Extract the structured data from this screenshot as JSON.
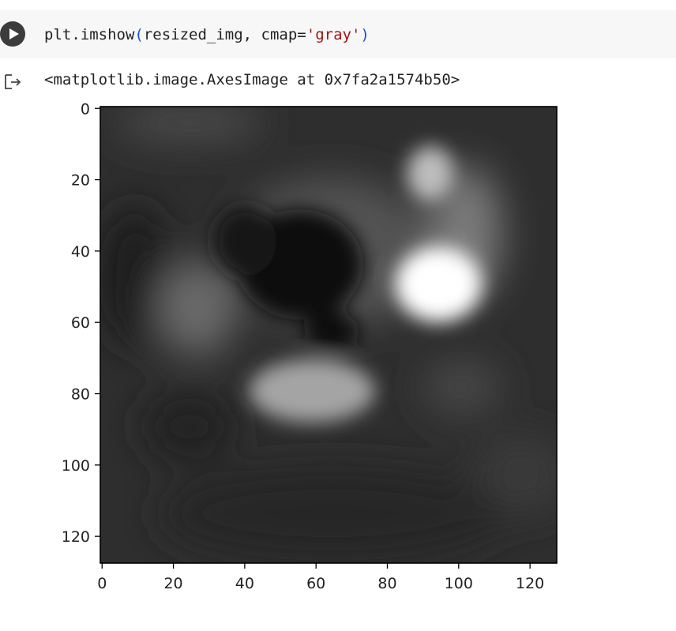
{
  "cell": {
    "code": {
      "fn": "plt.imshow",
      "open_paren": "(",
      "args": "resized_img, cmap=",
      "string_arg": "'gray'",
      "close_paren": ")"
    },
    "output": "<matplotlib.image.AxesImage at 0x7fa2a1574b50>"
  },
  "colors": {
    "run_button": "#3c3c3c",
    "cell_background": "#f7f7f7",
    "paren": "#1a4fd6",
    "string": "#a31515"
  },
  "icons": {
    "run": "play-circle-icon",
    "output": "output-arrow-icon"
  },
  "chart_data": {
    "type": "heatmap",
    "colormap": "gray",
    "image_size": [
      128,
      128
    ],
    "xlim": [
      0,
      127
    ],
    "ylim": [
      127,
      0
    ],
    "xticks": [
      "0",
      "20",
      "40",
      "60",
      "80",
      "100",
      "120"
    ],
    "yticks": [
      "0",
      "20",
      "40",
      "60",
      "80",
      "100",
      "120"
    ],
    "regions": [
      {
        "label": "bright-spot",
        "center": [
          96,
          48
        ],
        "intensity": 1.0
      },
      {
        "label": "dark-blob",
        "center": [
          55,
          45
        ],
        "intensity": 0.0
      },
      {
        "label": "lower-light-patch",
        "center": [
          62,
          84
        ],
        "intensity": 0.6
      }
    ]
  }
}
